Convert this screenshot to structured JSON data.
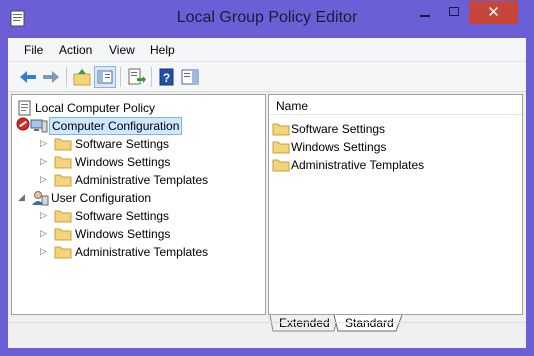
{
  "window": {
    "title": "Local Group Policy Editor"
  },
  "menu": [
    "File",
    "Action",
    "View",
    "Help"
  ],
  "tree": {
    "root": "Local Computer Policy",
    "computer": {
      "label": "Computer Configuration",
      "children": [
        "Software Settings",
        "Windows Settings",
        "Administrative Templates"
      ]
    },
    "user": {
      "label": "User Configuration",
      "children": [
        "Software Settings",
        "Windows Settings",
        "Administrative Templates"
      ]
    }
  },
  "list": {
    "column": "Name",
    "items": [
      "Software Settings",
      "Windows Settings",
      "Administrative Templates"
    ]
  },
  "tabs": [
    "Extended",
    "Standard"
  ],
  "colors": {
    "titlebar": "#6b5fd6",
    "close": "#c7453a",
    "selection": "#cde8ff",
    "folder": "#f5d37a"
  }
}
